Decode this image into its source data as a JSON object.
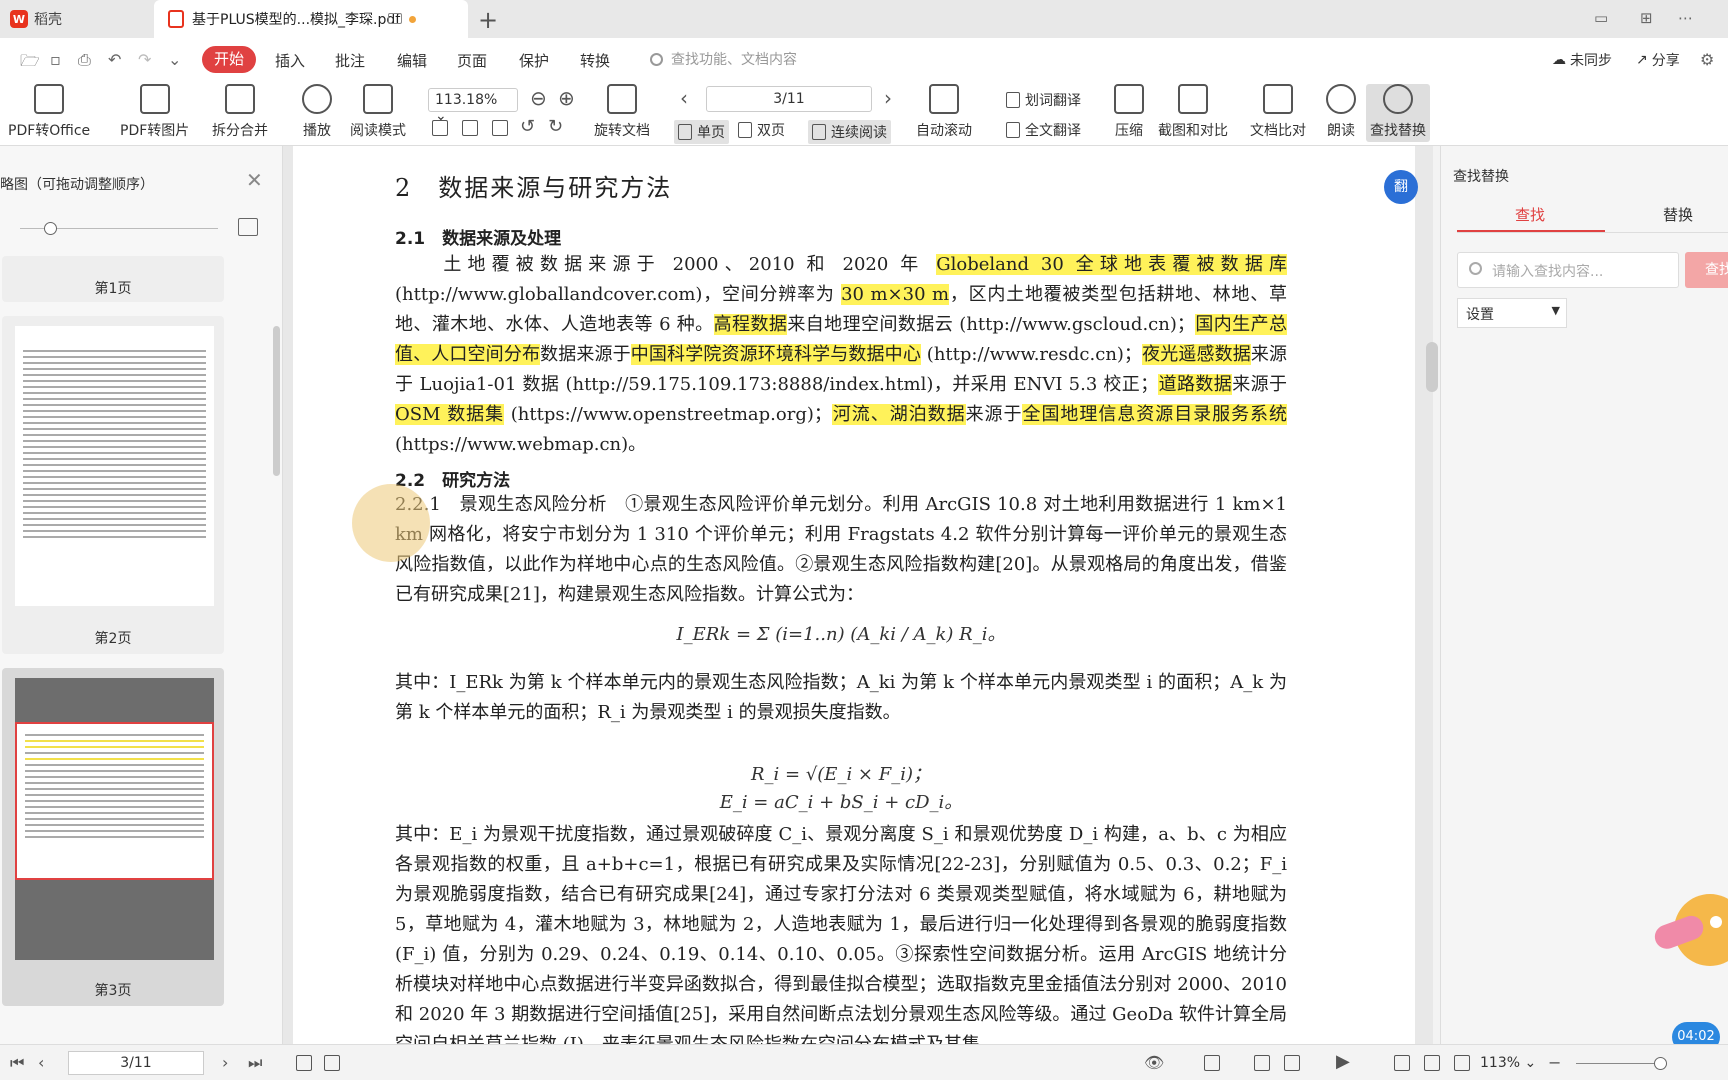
{
  "tabs": [
    {
      "label": "稻壳"
    },
    {
      "label": "基于PLUS模型的...模拟_李琛.pdf"
    }
  ],
  "menubar": {
    "items": [
      "开始",
      "插入",
      "批注",
      "编辑",
      "页面",
      "保护",
      "转换"
    ],
    "search_placeholder": "查找功能、文档内容",
    "sync": "未同步",
    "share": "分享"
  },
  "ribbon": {
    "pdf_to_office": "PDF转Office",
    "pdf_to_image": "PDF转图片",
    "split_merge": "拆分合并",
    "play": "播放",
    "read_mode": "阅读模式",
    "zoom": "113.18%",
    "rotate": "旋转文档",
    "page_indicator": "3/11",
    "single": "单页",
    "double": "双页",
    "continuous": "连续阅读",
    "auto_scroll": "自动滚动",
    "word_translate": "划词翻译",
    "full_translate": "全文翻译",
    "compress": "压缩",
    "screenshot_compare": "截图和对比",
    "doc_compare": "文档比对",
    "read_aloud": "朗读",
    "find_replace": "查找替换"
  },
  "sidebar": {
    "title": "略图（可拖动调整顺序）",
    "pages": [
      "第1页",
      "第2页",
      "第3页"
    ]
  },
  "document": {
    "h_section": "2　数据来源与研究方法",
    "h_21": "2.1　数据来源及处理",
    "p1": [
      {
        "t": "　　土地覆被数据来源于 2000、2010 和 2020 年 ",
        "h": false
      },
      {
        "t": "Globeland 30 全球地表覆被数据库",
        "h": true
      },
      {
        "t": " (http://www.globallandcover.com)，空间分辨率为 ",
        "h": false
      },
      {
        "t": "30 m×30 m",
        "h": true
      },
      {
        "t": "，区内土地覆被类型包括耕地、林地、草地、灌木地、水体、人造地表等 6 种。",
        "h": false
      },
      {
        "t": "高程数据",
        "h": true
      },
      {
        "t": "来自地理空间数据云 (http://www.gscloud.cn)；",
        "h": false
      },
      {
        "t": "国内生产总值、人口空间分布",
        "h": true
      },
      {
        "t": "数据来源于",
        "h": false
      },
      {
        "t": "中国科学院资源环境科学与数据中心",
        "h": true
      },
      {
        "t": " (http://www.resdc.cn)；",
        "h": false
      },
      {
        "t": "夜光遥感数据",
        "h": true
      },
      {
        "t": "来源于 Luojia1-01 数据 (http://59.175.109.173:8888/index.html)，并采用 ENVI 5.3 校正；",
        "h": false
      },
      {
        "t": "道路数据",
        "h": true
      },
      {
        "t": "来源于 ",
        "h": false
      },
      {
        "t": "OSM 数据集",
        "h": true
      },
      {
        "t": " (https://www.openstreetmap.org)；",
        "h": false
      },
      {
        "t": "河流、湖泊数据",
        "h": true
      },
      {
        "t": "来源于",
        "h": false
      },
      {
        "t": "全国地理信息资源目录服务系统",
        "h": true
      },
      {
        "t": " (https://www.webmap.cn)。",
        "h": false
      }
    ],
    "h_22": "2.2　研究方法",
    "p2": "2.2.1　景观生态风险分析　①景观生态风险评价单元划分。利用 ArcGIS 10.8 对土地利用数据进行 1 km×1 km 网格化，将安宁市划分为 1 310 个评价单元；利用 Fragstats 4.2 软件分别计算每一评价单元的景观生态风险指数值，以此作为样地中心点的生态风险值。②景观生态风险指数构建[20]。从景观格局的角度出发，借鉴已有研究成果[21]，构建景观生态风险指数。计算公式为：",
    "formula1": "I_ERk = Σ (i=1..n) (A_ki / A_k) R_i。",
    "p3": "其中：I_ERk 为第 k 个样本单元内的景观生态风险指数；A_ki 为第 k 个样本单元内景观类型 i 的面积；A_k 为第 k 个样本单元的面积；R_i 为景观类型 i 的景观损失度指数。",
    "formula2": "R_i = √(E_i × F_i)；",
    "formula3": "E_i = aC_i + bS_i + cD_i。",
    "p4": "其中：E_i 为景观干扰度指数，通过景观破碎度 C_i、景观分离度 S_i 和景观优势度 D_i 构建，a、b、c 为相应各景观指数的权重，且 a+b+c=1，根据已有研究成果及实际情况[22-23]，分别赋值为 0.5、0.3、0.2；F_i 为景观脆弱度指数，结合已有研究成果[24]，通过专家打分法对 6 类景观类型赋值，将水域赋为 6，耕地赋为 5，草地赋为 4，灌木地赋为 3，林地赋为 2，人造地表赋为 1，最后进行归一化处理得到各景观的脆弱度指数 (F_i) 值，分别为 0.29、0.24、0.19、0.14、0.10、0.05。③探索性空间数据分析。运用 ArcGIS 地统计分析模块对样地中心点数据进行半变异函数拟合，得到最佳拟合模型；选取指数克里金插值法分别对 2000、2010 和 2020 年 3 期数据进行空间插值[25]，采用自然间断点法划分景观生态风险等级。通过 GeoDa 软件计算全局空间自相关莫兰指数 (I)，来表征景观生态风险指数在空间分布模式及其集"
  },
  "right_panel": {
    "title": "查找替换",
    "tab_find": "查找",
    "tab_replace": "替换",
    "input_placeholder": "请输入查找内容...",
    "search_button": "查找",
    "settings": "设置"
  },
  "statusbar": {
    "page": "3/11",
    "zoom": "113%"
  },
  "time_badge": "04:02",
  "float_button": "翻",
  "colors": {
    "accent": "#e04141",
    "highlight": "#fff25a",
    "blue": "#2b6fd6"
  }
}
